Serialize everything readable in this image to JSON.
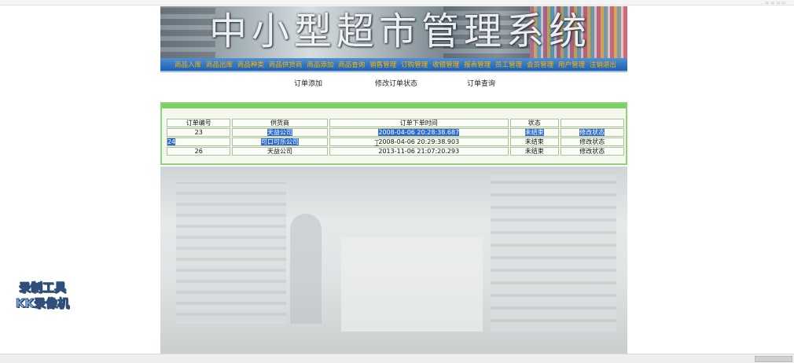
{
  "header": {
    "title": "中小型超市管理系统"
  },
  "menu": [
    "商品入库",
    "商品出库",
    "商品种类",
    "商品供货商",
    "商品添加",
    "商品查询",
    "销售管理",
    "订购管理",
    "收银管理",
    "报表管理",
    "员工管理",
    "会员管理",
    "用户管理",
    "注销退出"
  ],
  "subnav": {
    "add_order": "订单添加",
    "modify_status": "修改订单状态",
    "query_order": "订单查询"
  },
  "table": {
    "headers": [
      "订单编号",
      "供货商",
      "订单下单时间",
      "状态",
      ""
    ],
    "rows": [
      {
        "id": "23",
        "supplier": "天益公司",
        "time": "2008-04-06 20:28:38.687",
        "status": "未结束",
        "action": "修改状态"
      },
      {
        "id": "24",
        "supplier": "可口可乐公司",
        "time": "2008-04-06 20:29:38.903",
        "status": "未结束",
        "action": "修改状态"
      },
      {
        "id": "26",
        "supplier": "天益公司",
        "time": "2013-11-06 21:07:20.293",
        "status": "未结束",
        "action": "修改状态"
      }
    ]
  },
  "watermark": {
    "line1": "录制工具",
    "line2": "KK录像机"
  }
}
